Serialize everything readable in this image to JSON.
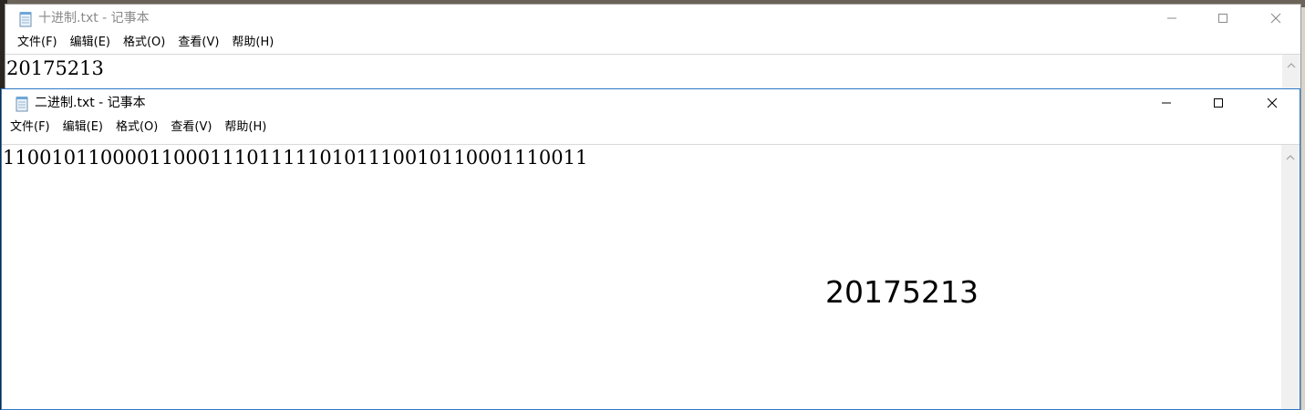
{
  "windows": {
    "decimal": {
      "title": "十进制.txt - 记事本",
      "content": "20175213",
      "menu": [
        "文件(F)",
        "编辑(E)",
        "格式(O)",
        "查看(V)",
        "帮助(H)"
      ]
    },
    "binary": {
      "title": "二进制.txt - 记事本",
      "content": "110010110000110001110111110101110010110001110011",
      "menu": [
        "文件(F)",
        "编辑(E)",
        "格式(O)",
        "查看(V)",
        "帮助(H)"
      ]
    }
  },
  "overlay_text": "20175213",
  "icons": {
    "app": "notepad-icon",
    "minimize": "minimize-icon",
    "maximize": "maximize-icon",
    "close": "close-icon",
    "scroll_up": "chevron-up-icon"
  },
  "colors": {
    "active_border": "#2b79c9",
    "inactive_title": "#8a8a8a",
    "scrollbar": "#f0f0f0"
  }
}
